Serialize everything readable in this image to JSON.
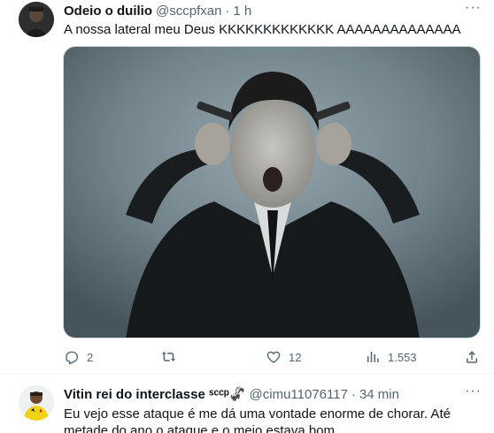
{
  "tweets": [
    {
      "display_name": "Odeio o duilio",
      "handle": "@sccpfxan",
      "separator": "·",
      "time": "1 h",
      "text": "A nossa lateral meu Deus KKKKKKKKKKKKK AAAAAAAAAAAAAA",
      "more": "···",
      "reply_count": "2",
      "retweet_count": "",
      "like_count": "12",
      "view_count": "1.553"
    },
    {
      "display_name": "Vitin rei do interclasse ˢᶜᶜᵖ🦨",
      "handle": "@cimu11076117",
      "separator": "·",
      "time": "34 min",
      "text": "Eu vejo esse ataque é me dá uma vontade enorme de chorar. Até metade do ano o ataque e o meio estava bom",
      "more": "···"
    }
  ],
  "icons": {
    "reply": "reply-icon",
    "retweet": "retweet-icon",
    "like": "like-icon",
    "views": "views-icon",
    "share": "share-icon",
    "more": "more-icon"
  },
  "colors": {
    "text_primary": "#0f1419",
    "text_secondary": "#536471",
    "divider": "#eff3f4"
  }
}
